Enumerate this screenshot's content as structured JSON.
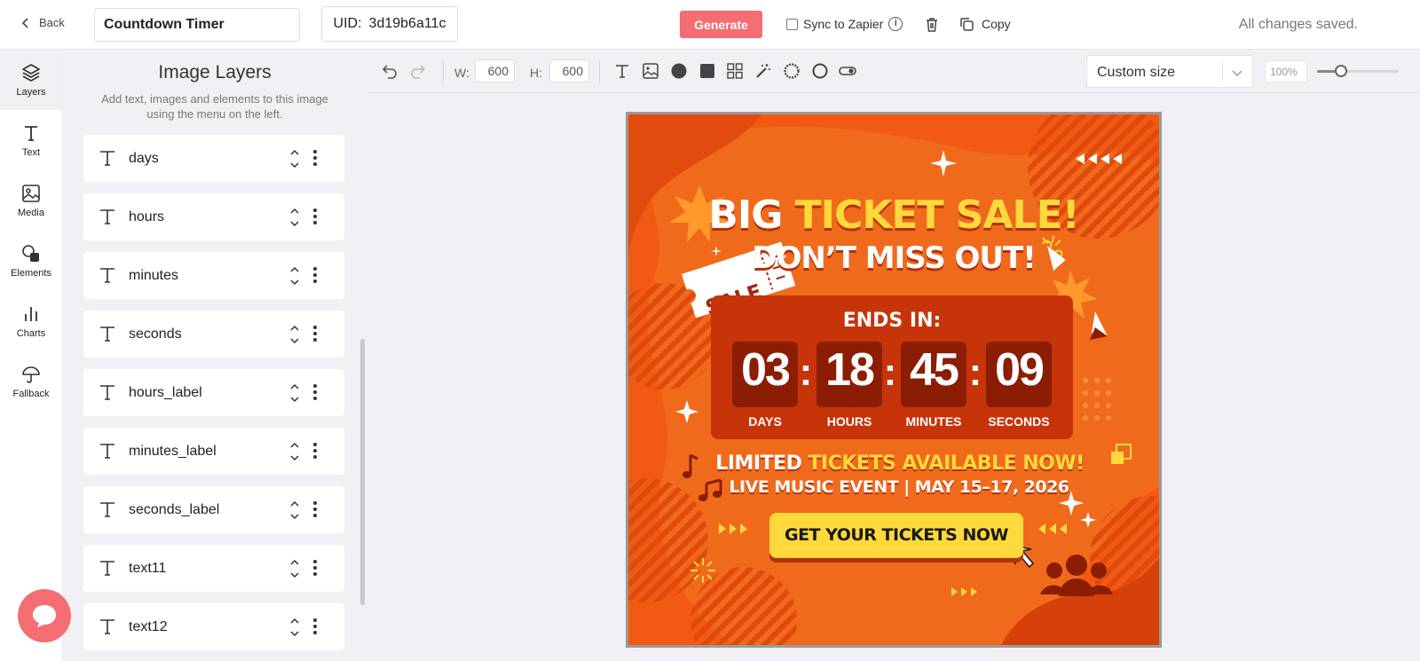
{
  "topbar": {
    "back_label": "Back",
    "title_value": "Countdown Timer",
    "uid_label": "UID:",
    "uid_value": "3d19b6a11c",
    "generate_label": "Generate",
    "sync_label": "Sync to Zapier",
    "copy_label": "Copy",
    "status": "All changes saved."
  },
  "rail": {
    "items": [
      {
        "label": "Layers",
        "icon": "layers-icon"
      },
      {
        "label": "Text",
        "icon": "text-icon"
      },
      {
        "label": "Media",
        "icon": "image-icon"
      },
      {
        "label": "Elements",
        "icon": "shapes-icon"
      },
      {
        "label": "Charts",
        "icon": "bar-chart-icon"
      },
      {
        "label": "Fallback",
        "icon": "umbrella-icon"
      }
    ]
  },
  "panel": {
    "title": "Image Layers",
    "subtitle": "Add text, images and elements to this image using the menu on the left.",
    "layers": [
      {
        "name": "days"
      },
      {
        "name": "hours"
      },
      {
        "name": "minutes"
      },
      {
        "name": "seconds"
      },
      {
        "name": "hours_label"
      },
      {
        "name": "minutes_label"
      },
      {
        "name": "seconds_label"
      },
      {
        "name": "text11"
      },
      {
        "name": "text12"
      }
    ]
  },
  "toolbar": {
    "width_label": "W:",
    "width_value": "600",
    "height_label": "H:",
    "height_value": "600",
    "size_preset": "Custom size",
    "zoom": "100%",
    "zoom_fraction": 0.3
  },
  "poster": {
    "headline_white": "BIG ",
    "headline_yellow": "TICKET SALE!",
    "subheadline": "DON’T MISS OUT!",
    "sale_tag": "SALE",
    "ends_in": "ENDS IN:",
    "days": "03",
    "hours": "18",
    "minutes": "45",
    "seconds": "09",
    "colon": ":",
    "days_label": "DAYS",
    "hours_label": "HOURS",
    "minutes_label": "MINUTES",
    "seconds_label": "SECONDS",
    "limited_white": "LIMITED ",
    "limited_yellow": "TICKETS AVAILABLE NOW!",
    "event_line": "LIVE MUSIC EVENT | MAY 15–17, 2026",
    "cta": "GET YOUR TICKETS NOW",
    "colors": {
      "orange": "#f25a14",
      "dark_orange": "#c7340a",
      "yellow": "#ffd93b",
      "digit_bg": "#8b1d05"
    }
  },
  "colors": {
    "accent": "#f36d72",
    "panel_bg": "#f1f1f5"
  }
}
